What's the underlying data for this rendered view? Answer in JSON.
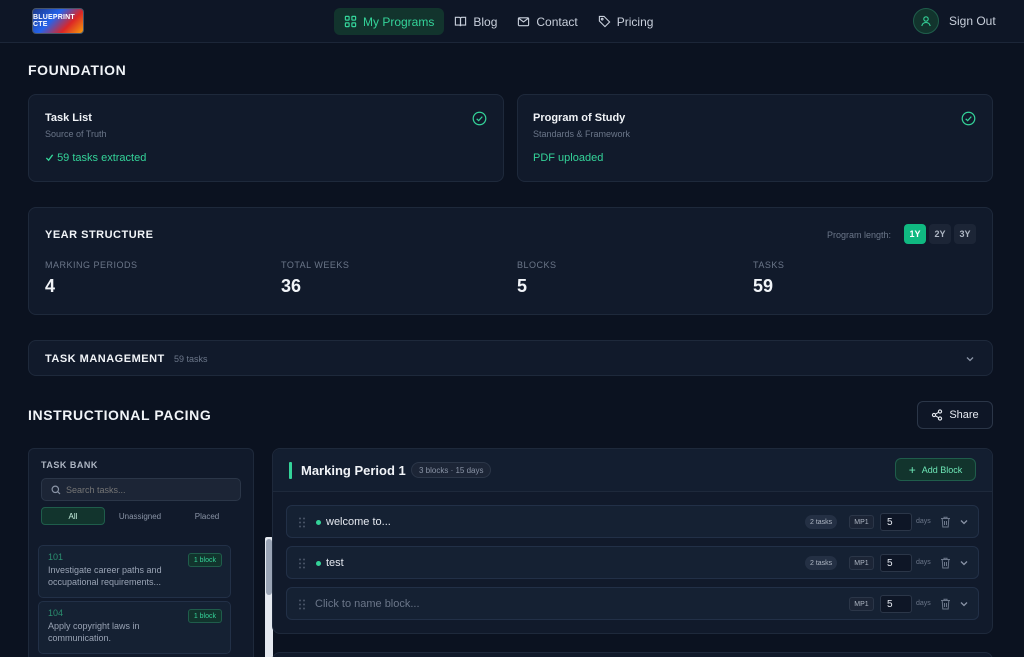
{
  "header": {
    "logo_text": "BLUEPRINT CTE",
    "nav": [
      {
        "label": "My Programs",
        "icon": "grid-icon",
        "active": true
      },
      {
        "label": "Blog",
        "icon": "book-icon",
        "active": false
      },
      {
        "label": "Contact",
        "icon": "mail-icon",
        "active": false
      },
      {
        "label": "Pricing",
        "icon": "tag-icon",
        "active": false
      }
    ],
    "signout_label": "Sign Out"
  },
  "foundation": {
    "title": "FOUNDATION",
    "task_list": {
      "title": "Task List",
      "subtitle": "Source of Truth",
      "status": "59 tasks extracted"
    },
    "program_of_study": {
      "title": "Program of Study",
      "subtitle": "Standards & Framework",
      "status": "PDF uploaded"
    }
  },
  "year_structure": {
    "title": "YEAR STRUCTURE",
    "program_length_label": "Program length:",
    "length_options": [
      "1Y",
      "2Y",
      "3Y"
    ],
    "selected_length": "1Y",
    "stats": [
      {
        "label": "MARKING PERIODS",
        "value": "4"
      },
      {
        "label": "TOTAL WEEKS",
        "value": "36"
      },
      {
        "label": "BLOCKS",
        "value": "5"
      },
      {
        "label": "TASKS",
        "value": "59"
      }
    ]
  },
  "task_management": {
    "title": "TASK MANAGEMENT",
    "count": "59 tasks"
  },
  "pacing": {
    "title": "INSTRUCTIONAL PACING",
    "share_label": "Share"
  },
  "task_bank": {
    "title": "TASK BANK",
    "search_placeholder": "Search tasks...",
    "tabs": [
      "All",
      "Unassigned",
      "Placed"
    ],
    "items": [
      {
        "number": "101",
        "text": "Investigate career paths and occupational requirements...",
        "badge": "1 block"
      },
      {
        "number": "104",
        "text": "Apply copyright laws in communication.",
        "badge": "1 block"
      }
    ]
  },
  "marking_period": {
    "title": "Marking Period 1",
    "summary": "3 blocks · 15 days",
    "add_block_label": "Add Block",
    "blocks": [
      {
        "name": "welcome to...",
        "tasks": "2 tasks",
        "mp": "MP1",
        "days": "5",
        "days_label": "days"
      },
      {
        "name": "test",
        "tasks": "2 tasks",
        "mp": "MP1",
        "days": "5",
        "days_label": "days"
      },
      {
        "name": "Click to name block...",
        "tasks": "",
        "mp": "MP1",
        "days": "5",
        "days_label": "days"
      }
    ]
  },
  "colors": {
    "accent": "#34d399",
    "background": "#0b1220",
    "card": "#111a2b"
  }
}
